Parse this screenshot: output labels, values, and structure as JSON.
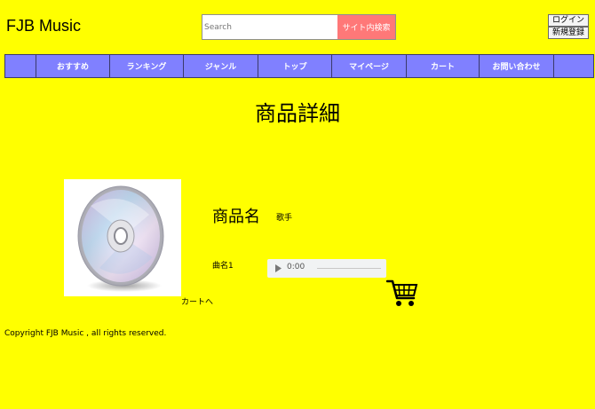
{
  "header": {
    "logo": "FJB Music",
    "search_placeholder": "Search",
    "search_button": "サイト内検索",
    "login_label": "ログイン",
    "register_label": "新規登録"
  },
  "nav": {
    "items": [
      "",
      "おすすめ",
      "ランキング",
      "ジャンル",
      "トップ",
      "マイページ",
      "カート",
      "お問い合わせ",
      ""
    ]
  },
  "main": {
    "page_title": "商品詳細",
    "product_name": "商品名",
    "artist": "歌手",
    "song_name": "曲名1",
    "audio_time": "0:00",
    "cart_link": "カートへ"
  },
  "footer": {
    "copyright": "Copyright FJB Music , all rights reserved."
  },
  "colors": {
    "background": "#ffff00",
    "nav": "#8080ff",
    "search_button": "#ff7878"
  },
  "icons": [
    "cd-image",
    "play-icon",
    "cart-icon"
  ]
}
